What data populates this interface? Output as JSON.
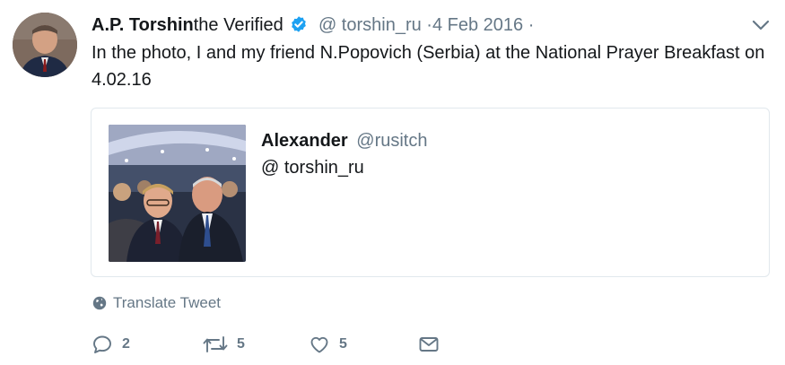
{
  "tweet": {
    "author_name": "A.P. Torshin",
    "verified_label": "the Verified",
    "handle": "@ torshin_ru",
    "separator": "·",
    "date": "4 Feb 2016",
    "trailing_separator": "·",
    "text": "In the photo, I and my friend N.Popovich (Serbia) at the National Prayer Breakfast on 4.02.16"
  },
  "quote": {
    "name": "Alexander",
    "handle": "@rusitch",
    "text": "@ torshin_ru"
  },
  "translate_label": "Translate Tweet",
  "actions": {
    "reply_count": "2",
    "retweet_count": "5",
    "like_count": "5"
  },
  "colors": {
    "text": "#14171a",
    "muted": "#657786",
    "verified": "#1da1f2",
    "border": "#e1e8ed"
  },
  "icons": [
    "verified-badge-icon",
    "chevron-down-icon",
    "globe-icon",
    "reply-icon",
    "retweet-icon",
    "like-icon",
    "direct-message-icon"
  ]
}
